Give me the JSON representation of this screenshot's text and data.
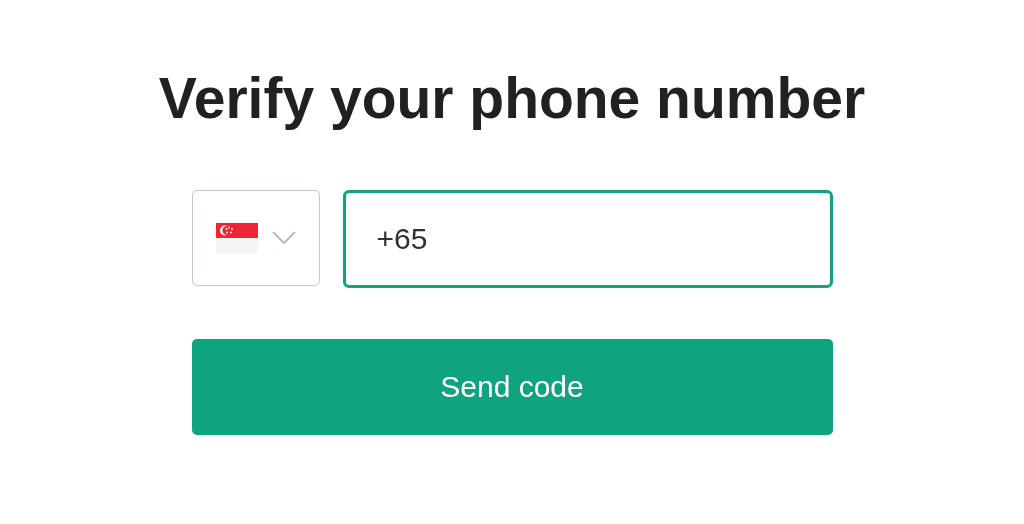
{
  "title": "Verify your phone number",
  "country_select": {
    "expanded": false
  },
  "phone_field": {
    "value": "+65",
    "focused": true
  },
  "submit_button": {
    "label": "Send code"
  }
}
